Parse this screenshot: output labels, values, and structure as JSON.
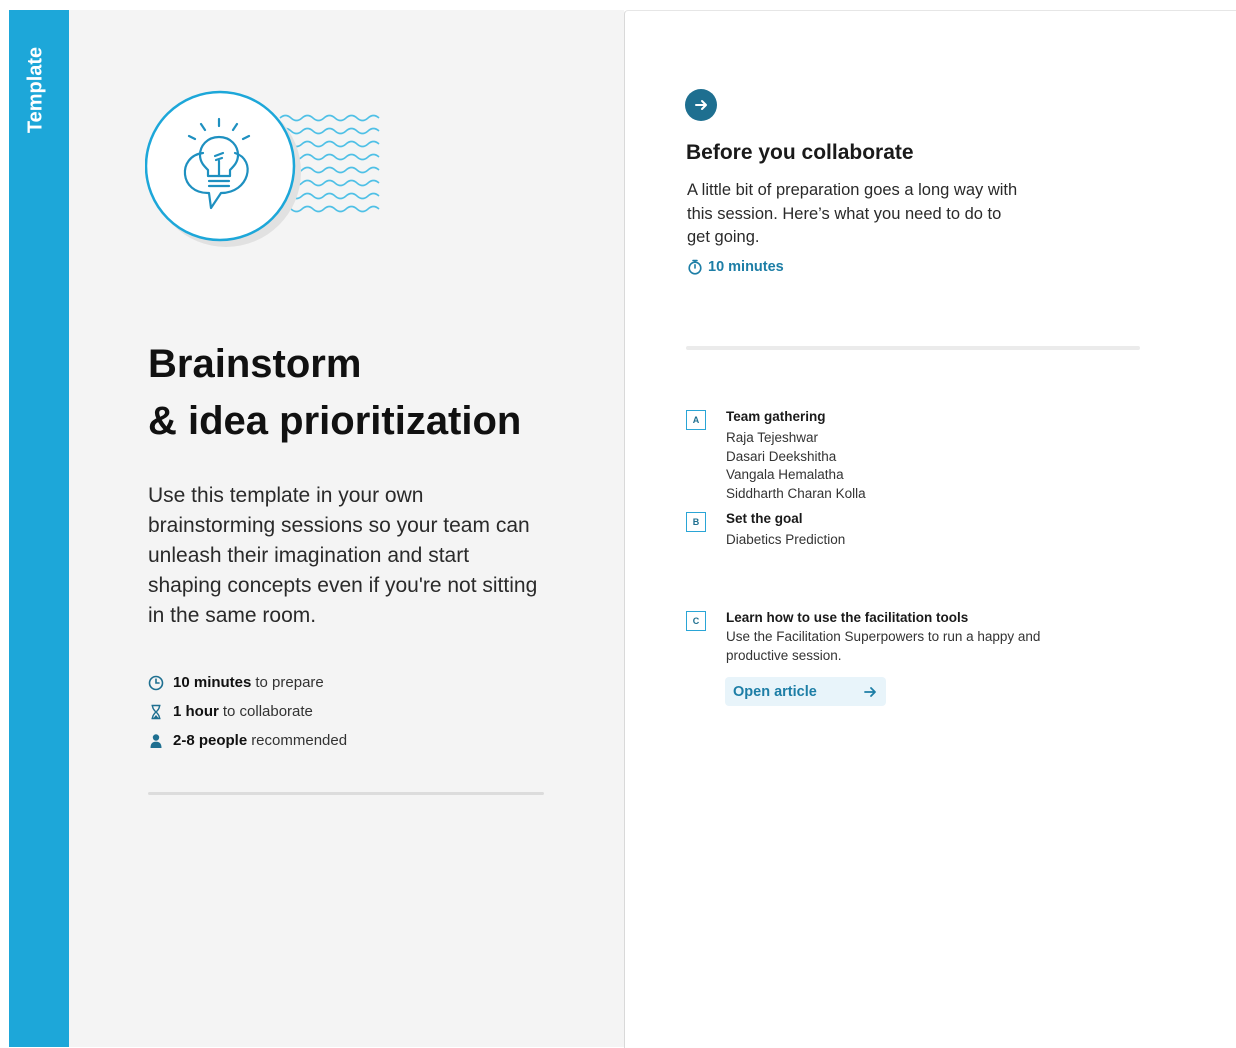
{
  "tab": {
    "label": "Template"
  },
  "intro": {
    "title_line1": "Brainstorm",
    "title_line2": "& idea prioritization",
    "description": "Use this template in your own brainstorming sessions so your team can unleash their imagination and start shaping concepts even if you're not sitting in the same room.",
    "stats": [
      {
        "icon": "clock-icon",
        "bold": "10 minutes",
        "text": "to prepare"
      },
      {
        "icon": "hourglass-icon",
        "bold": "1 hour",
        "text": "to collaborate"
      },
      {
        "icon": "person-icon",
        "bold": "2-8 people",
        "text": "recommended"
      }
    ]
  },
  "prep": {
    "title": "Before you collaborate",
    "description": "A little bit of preparation goes a long way with this session. Here’s what you need to do to get going.",
    "duration": "10 minutes",
    "steps": [
      {
        "letter": "A",
        "title": "Team gathering",
        "lines": [
          "Raja Tejeshwar",
          "Dasari Deekshitha",
          "Vangala Hemalatha",
          "Siddharth Charan Kolla"
        ]
      },
      {
        "letter": "B",
        "title": "Set the goal",
        "lines": [
          "Diabetics Prediction"
        ]
      },
      {
        "letter": "C",
        "title": "Learn how to use the facilitation tools",
        "lines": [
          "Use the Facilitation Superpowers to run a happy and",
          "productive session."
        ]
      }
    ],
    "open_article_label": "Open article"
  },
  "colors": {
    "accent": "#1da7d9",
    "dark_accent": "#1e6f90",
    "link": "#1d7ea6"
  }
}
